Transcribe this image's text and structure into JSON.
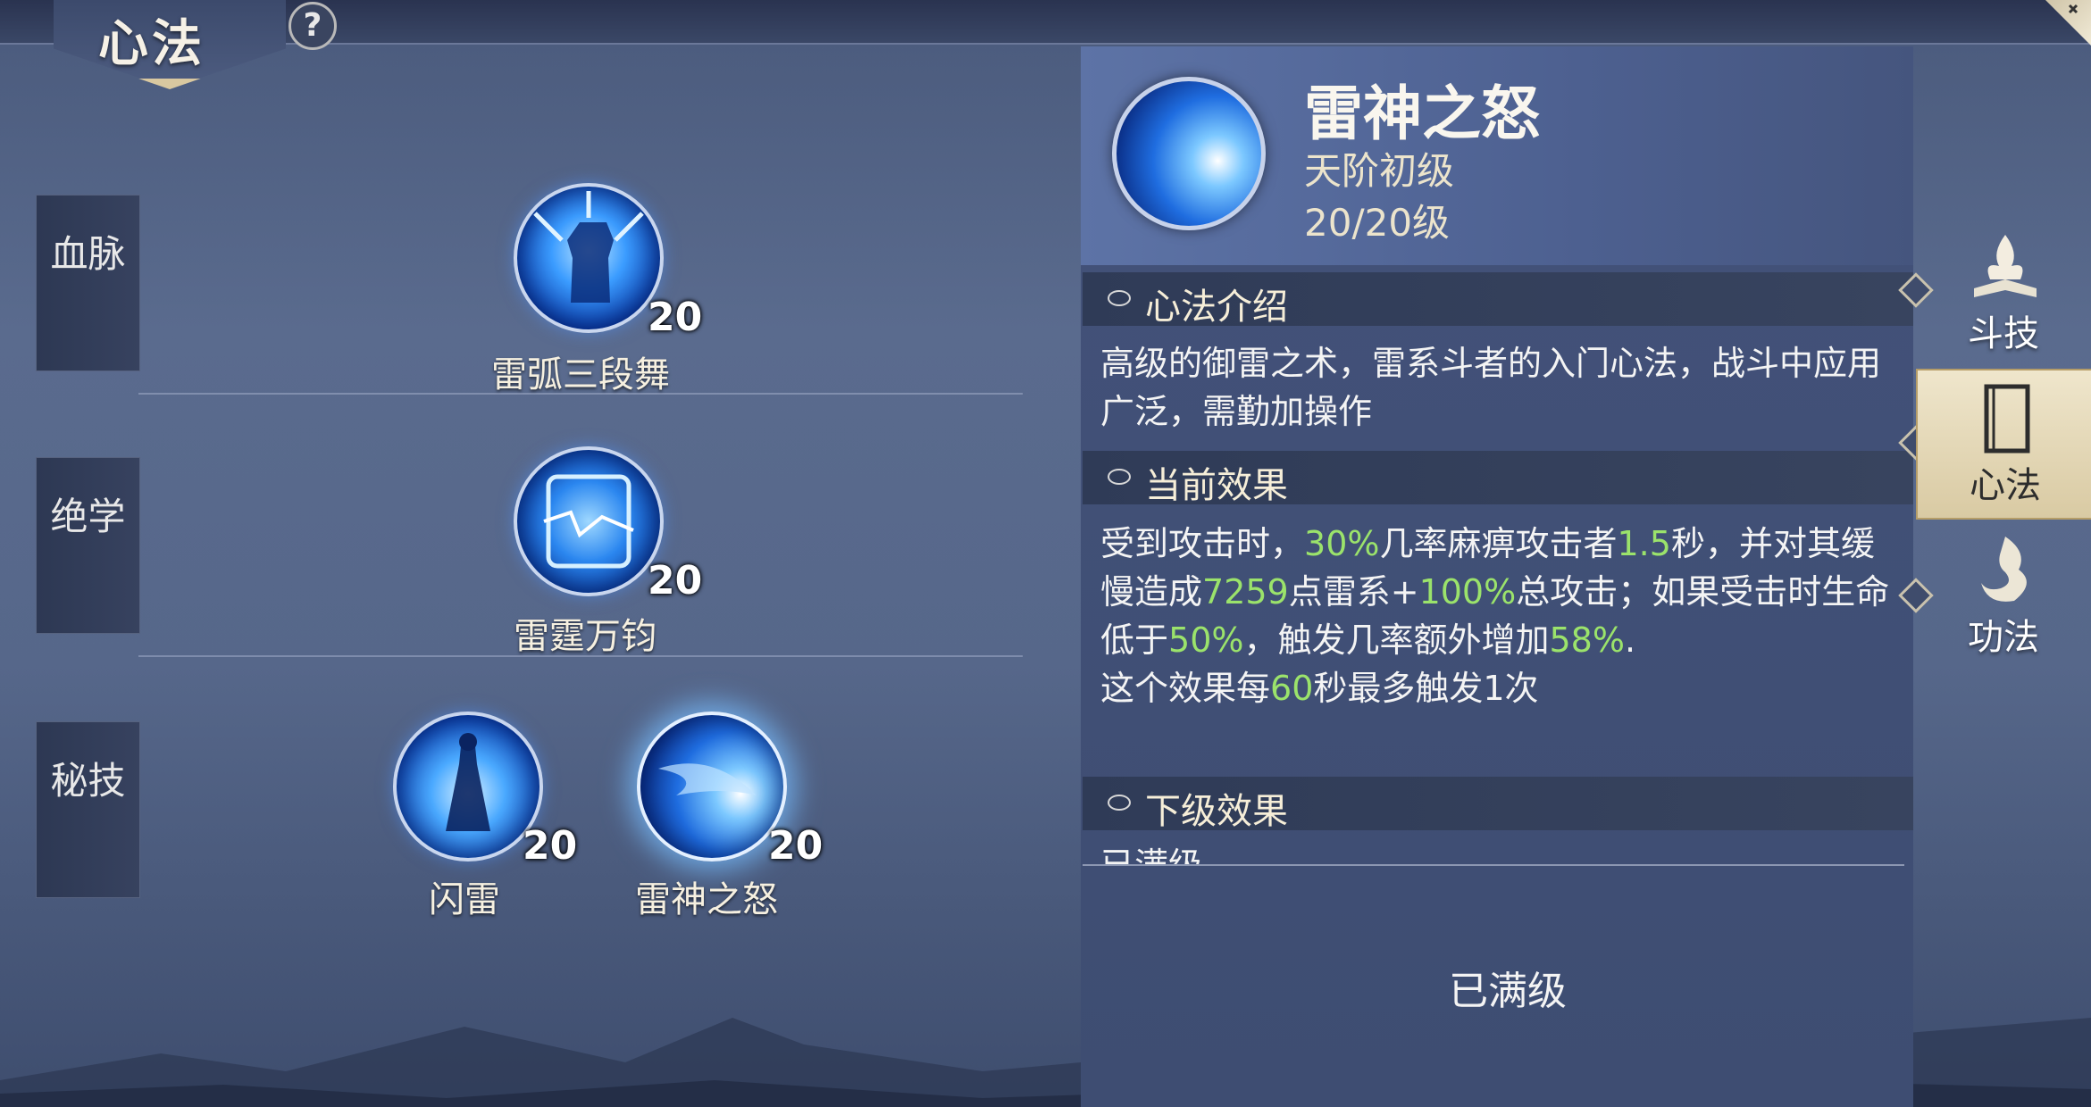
{
  "header": {
    "title": "心法",
    "help": "?",
    "close": "✕"
  },
  "rows": [
    {
      "tab": "血脉"
    },
    {
      "tab": "绝学"
    },
    {
      "tab": "秘技"
    }
  ],
  "skills": {
    "s1": {
      "name": "雷弧三段舞",
      "level": "20"
    },
    "s2": {
      "name": "雷霆万钧",
      "level": "20"
    },
    "s3": {
      "name": "闪雷",
      "level": "20"
    },
    "s4": {
      "name": "雷神之怒",
      "level": "20"
    }
  },
  "detail": {
    "name": "雷神之怒",
    "grade": "天阶初级",
    "level": "20/20级",
    "intro_title": "心法介绍",
    "intro_text": "高级的御雷之术，雷系斗者的入门心法，战斗中应用广泛，需勤加操作",
    "current_title": "当前效果",
    "cur_a": "受到攻击时，",
    "cur_chance": "30%",
    "cur_b": "几率麻痹攻击者",
    "cur_secs": "1.5",
    "cur_c": "秒，并对其缓慢造成",
    "cur_dmg": "7259",
    "cur_d": "点雷系+",
    "cur_pct": "100%",
    "cur_e": "总攻击；如果受击时生命低于",
    "cur_hp": "50%",
    "cur_f": "，触发几率额外增加",
    "cur_extra": "58%",
    "cur_g": ".",
    "cur_h": "这个效果每",
    "cur_cd": "60",
    "cur_i": "秒最多触发1次",
    "next_title": "下级效果",
    "next_text": "已满级",
    "max_label": "已满级"
  },
  "nav": [
    {
      "label": "斗技",
      "icon": "flame-book-icon"
    },
    {
      "label": "心法",
      "icon": "book-icon",
      "active": true
    },
    {
      "label": "功法",
      "icon": "swirl-flame-icon"
    }
  ],
  "colors": {
    "highlight": "#9be36b",
    "accent_gold": "#d9c8a0"
  }
}
